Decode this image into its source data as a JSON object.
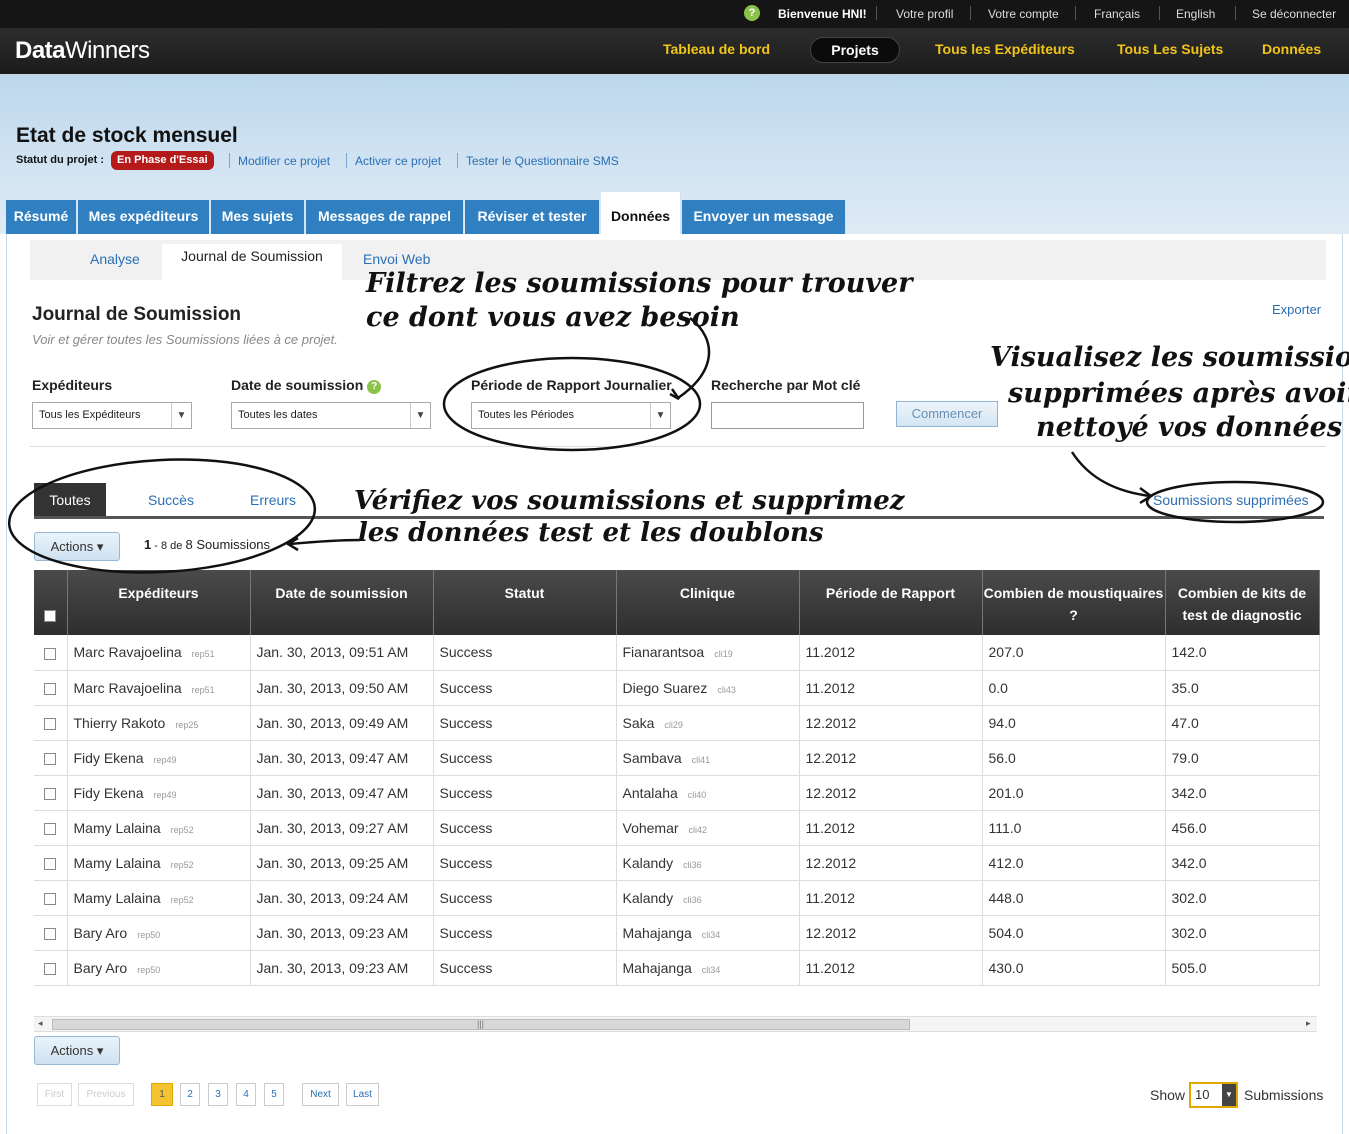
{
  "topbar": {
    "welcome": "Bienvenue HNI!",
    "links": [
      "Votre profil",
      "Votre compte",
      "Français",
      "English",
      "Se déconnecter"
    ]
  },
  "nav": {
    "logo_bold": "Data",
    "logo_rest": "Winners",
    "items": [
      "Tableau de bord",
      "Projets",
      "Tous les Expéditeurs",
      "Tous Les Sujets",
      "Données"
    ],
    "active": "Projets"
  },
  "project": {
    "title": "Etat de stock mensuel",
    "status_label": "Statut du projet :",
    "status_badge": "En Phase d'Essai",
    "links": [
      "Modifier ce projet",
      "Activer ce projet",
      "Tester le Questionnaire SMS"
    ]
  },
  "project_tabs": [
    "Résumé",
    "Mes expéditeurs",
    "Mes sujets",
    "Messages de rappel",
    "Réviser et tester",
    "Données",
    "Envoyer un message"
  ],
  "subtabs": [
    "Analyse",
    "Journal de Soumission",
    "Envoi Web"
  ],
  "section": {
    "title": "Journal de Soumission",
    "subtitle": "Voir et gérer toutes les Soumissions liées à ce projet.",
    "export": "Exporter"
  },
  "filters": {
    "sender_label": "Expéditeurs",
    "sender_value": "Tous les Expéditeurs",
    "date_label": "Date de soumission",
    "date_value": "Toutes les dates",
    "period_label": "Période de Rapport Journalier",
    "period_value": "Toutes les Périodes",
    "keyword_label": "Recherche par Mot clé",
    "keyword_value": "",
    "go_button": "Commencer"
  },
  "status_tabs": [
    "Toutes",
    "Succès",
    "Erreurs"
  ],
  "deleted_link": "Soumissions supprimées",
  "actions_label": "Actions",
  "count": {
    "range_start": "1",
    "range_sep": " - 8 de ",
    "total": "8",
    "unit": " Soumissions"
  },
  "table": {
    "columns": [
      "Expéditeurs",
      "Date de soumission",
      "Statut",
      "Clinique",
      "Période de Rapport",
      "Combien de moustiquaires ?",
      "Combien de kits de test de diagnostic"
    ],
    "rows": [
      {
        "sender": "Marc Ravajoelina",
        "sender_id": "rep51",
        "date": "Jan. 30, 2013, 09:51 AM",
        "status": "Success",
        "clinic": "Fianarantsoa",
        "clinic_id": "cli19",
        "period": "11.2012",
        "nets": "207.0",
        "kits": "142.0"
      },
      {
        "sender": "Marc Ravajoelina",
        "sender_id": "rep51",
        "date": "Jan. 30, 2013, 09:50 AM",
        "status": "Success",
        "clinic": "Diego Suarez",
        "clinic_id": "cli43",
        "period": "11.2012",
        "nets": "0.0",
        "kits": "35.0"
      },
      {
        "sender": "Thierry Rakoto",
        "sender_id": "rep25",
        "date": "Jan. 30, 2013, 09:49 AM",
        "status": "Success",
        "clinic": "Saka",
        "clinic_id": "cli29",
        "period": "12.2012",
        "nets": "94.0",
        "kits": "47.0"
      },
      {
        "sender": "Fidy Ekena",
        "sender_id": "rep49",
        "date": "Jan. 30, 2013, 09:47 AM",
        "status": "Success",
        "clinic": "Sambava",
        "clinic_id": "cli41",
        "period": "12.2012",
        "nets": "56.0",
        "kits": "79.0"
      },
      {
        "sender": "Fidy Ekena",
        "sender_id": "rep49",
        "date": "Jan. 30, 2013, 09:47 AM",
        "status": "Success",
        "clinic": "Antalaha",
        "clinic_id": "cli40",
        "period": "12.2012",
        "nets": "201.0",
        "kits": "342.0"
      },
      {
        "sender": "Mamy Lalaina",
        "sender_id": "rep52",
        "date": "Jan. 30, 2013, 09:27 AM",
        "status": "Success",
        "clinic": "Vohemar",
        "clinic_id": "cli42",
        "period": "11.2012",
        "nets": "111.0",
        "kits": "456.0"
      },
      {
        "sender": "Mamy Lalaina",
        "sender_id": "rep52",
        "date": "Jan. 30, 2013, 09:25 AM",
        "status": "Success",
        "clinic": "Kalandy",
        "clinic_id": "cli36",
        "period": "12.2012",
        "nets": "412.0",
        "kits": "342.0"
      },
      {
        "sender": "Mamy Lalaina",
        "sender_id": "rep52",
        "date": "Jan. 30, 2013, 09:24 AM",
        "status": "Success",
        "clinic": "Kalandy",
        "clinic_id": "cli36",
        "period": "11.2012",
        "nets": "448.0",
        "kits": "302.0"
      },
      {
        "sender": "Bary Aro",
        "sender_id": "rep50",
        "date": "Jan. 30, 2013, 09:23 AM",
        "status": "Success",
        "clinic": "Mahajanga",
        "clinic_id": "cli34",
        "period": "12.2012",
        "nets": "504.0",
        "kits": "302.0"
      },
      {
        "sender": "Bary Aro",
        "sender_id": "rep50",
        "date": "Jan. 30, 2013, 09:23 AM",
        "status": "Success",
        "clinic": "Mahajanga",
        "clinic_id": "cli34",
        "period": "11.2012",
        "nets": "430.0",
        "kits": "505.0"
      }
    ]
  },
  "pagination": {
    "first": "First",
    "previous": "Previous",
    "pages": [
      "1",
      "2",
      "3",
      "4",
      "5"
    ],
    "current": "1",
    "next": "Next",
    "last": "Last",
    "show_label": "Show",
    "show_value": "10",
    "show_suffix": "Submissions"
  },
  "annotations": {
    "filter_note_1": "Filtrez les soumissions pour trouver",
    "filter_note_2": "ce dont vous avez besoin",
    "deleted_note_1": "Visualisez les soumissions",
    "deleted_note_2": "supprimées après avoir",
    "deleted_note_3": "nettoyé vos données",
    "verify_note_1": "Vérifiez vos soumissions et supprimez",
    "verify_note_2": "les données test et les doublons"
  },
  "colors": {
    "accent_blue": "#2f7fc1",
    "nav_gold": "#f0c419",
    "badge_red": "#b41a1a",
    "link_blue": "#2a6fb5"
  }
}
